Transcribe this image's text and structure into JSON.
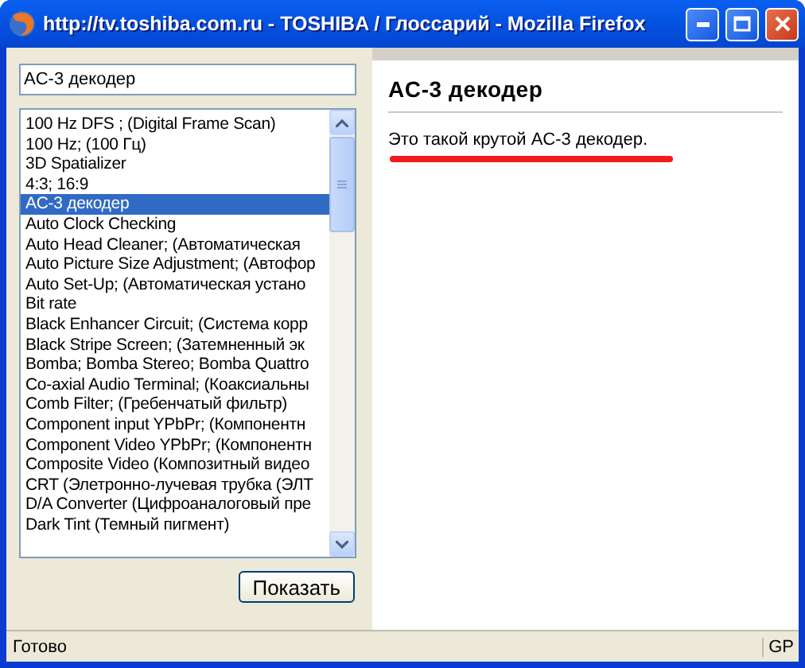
{
  "window": {
    "title": "http://tv.toshiba.com.ru - TOSHIBA / Глоссарий - Mozilla Firefox"
  },
  "search": {
    "value": "AC-3 декодер"
  },
  "terms": [
    {
      "label": "100 Hz DFS ; (Digital Frame Scan)",
      "selected": false
    },
    {
      "label": "100 Hz; (100 Гц)",
      "selected": false
    },
    {
      "label": "3D Spatializer",
      "selected": false
    },
    {
      "label": "4:3; 16:9",
      "selected": false
    },
    {
      "label": "AC-3 декодер",
      "selected": true
    },
    {
      "label": "Auto Clock Checking",
      "selected": false
    },
    {
      "label": "Auto Head Cleaner; (Автоматическая",
      "selected": false
    },
    {
      "label": "Auto Picture Size Adjustment; (Автофор",
      "selected": false
    },
    {
      "label": "Auto Set-Up; (Автоматическая устано",
      "selected": false
    },
    {
      "label": "Bit rate",
      "selected": false
    },
    {
      "label": "Black Enhancer Circuit; (Система корр",
      "selected": false
    },
    {
      "label": "Black Stripe Screen; (Затемненный эк",
      "selected": false
    },
    {
      "label": "Bomba; Bomba Stereo; Bomba Quattro",
      "selected": false
    },
    {
      "label": "Co-axial Audio Terminal; (Коаксиальны",
      "selected": false
    },
    {
      "label": "Comb Filter; (Гребенчатый фильтр)",
      "selected": false
    },
    {
      "label": "Component input YPbPr; (Компонентн",
      "selected": false
    },
    {
      "label": "Component Video YPbPr; (Компонентн",
      "selected": false
    },
    {
      "label": "Composite Video (Композитный видео",
      "selected": false
    },
    {
      "label": "CRT (Элетронно-лучевая трубка (ЭЛТ",
      "selected": false
    },
    {
      "label": "D/A Converter (Цифроаналоговый пре",
      "selected": false
    },
    {
      "label": "Dark Tint (Темный пигмент)",
      "selected": false
    }
  ],
  "show_button": "Показать",
  "article": {
    "heading": "AC-3 декодер",
    "text": "Это такой крутой AC-3 декодер."
  },
  "status_bar": {
    "text": "Готово",
    "panel": "GP"
  }
}
